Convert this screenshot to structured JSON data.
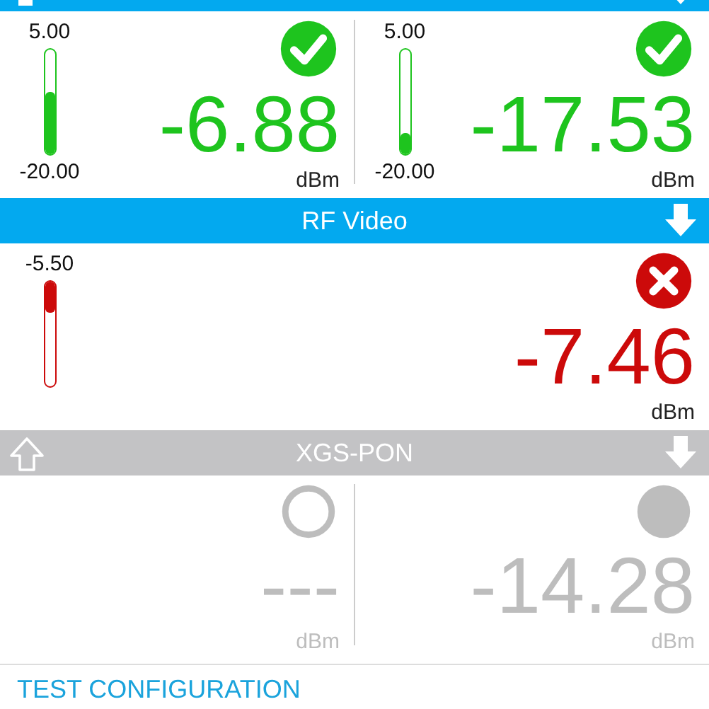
{
  "sections": [
    {
      "header": {
        "kind": "active",
        "clipped": true,
        "left_icon": {
          "kind": "up-filled"
        },
        "right_icon": {
          "kind": "down"
        }
      },
      "channels": [
        {
          "kind": "pass",
          "gauge": {
            "top_label": "5.00",
            "bottom_label": "-20.00",
            "level": 0.6,
            "from_top": false
          },
          "value": "-6.88",
          "unit": "dBm"
        },
        {
          "kind": "pass",
          "gauge": {
            "top_label": "5.00",
            "bottom_label": "-20.00",
            "level": 0.2,
            "from_top": false
          },
          "value": "-17.53",
          "unit": "dBm"
        }
      ]
    },
    {
      "header": {
        "kind": "active",
        "clipped": false,
        "title": "RF Video",
        "right_icon": {
          "kind": "down"
        }
      },
      "channels": [
        {
          "kind": "fail",
          "gauge": {
            "top_label": "-5.50",
            "level": 0.3,
            "from_top": true
          },
          "value": "-7.46",
          "unit": "dBm"
        }
      ]
    },
    {
      "header": {
        "kind": "inactive",
        "clipped": false,
        "title": "XGS-PON",
        "left_icon": {
          "kind": "up-outline"
        },
        "right_icon": {
          "kind": "down"
        }
      },
      "channels": [
        {
          "kind": "idle",
          "value": "---",
          "unit": "dBm"
        },
        {
          "kind": "pending",
          "value": "-14.28",
          "unit": "dBm"
        }
      ]
    }
  ],
  "footer": {
    "title": "TEST CONFIGURATION"
  }
}
